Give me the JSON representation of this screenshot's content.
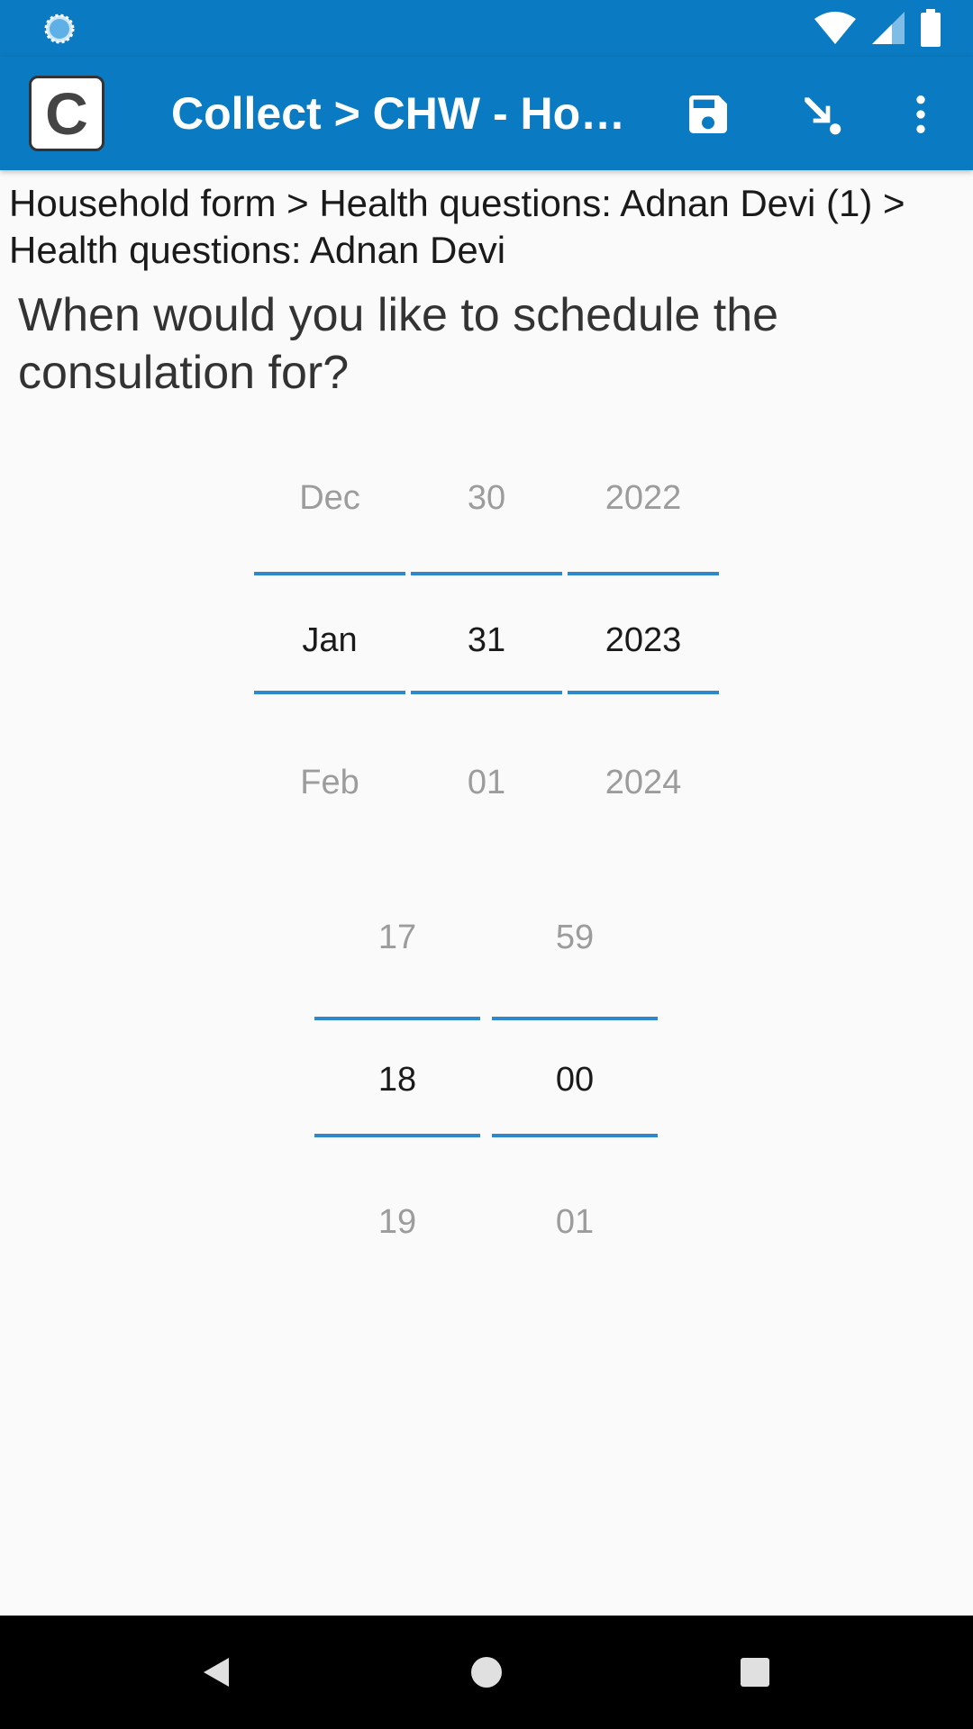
{
  "app_bar": {
    "logo_letter": "C",
    "title": "Collect > CHW - Ho…",
    "icons": [
      "save-icon",
      "jump-icon",
      "more-vert-icon"
    ]
  },
  "status_bar": {
    "icons": [
      "sync-icon",
      "wifi-icon",
      "cellular-signal-icon",
      "battery-icon"
    ]
  },
  "breadcrumb": "Household form > Health questions: Adnan Devi (1) > Health questions: Adnan Devi",
  "question": "When would you like to schedule the consulation for?",
  "date_picker": {
    "month": {
      "prev": "Dec",
      "current": "Jan",
      "next": "Feb"
    },
    "day": {
      "prev": "30",
      "current": "31",
      "next": "01"
    },
    "year": {
      "prev": "2022",
      "current": "2023",
      "next": "2024"
    }
  },
  "time_picker": {
    "hour": {
      "prev": "17",
      "current": "18",
      "next": "19"
    },
    "minute": {
      "prev": "59",
      "current": "00",
      "next": "01"
    }
  },
  "nav_bar": {
    "icons": [
      "back-icon",
      "home-icon",
      "recents-icon"
    ]
  },
  "colors": {
    "primary": "#0a7bc3",
    "picker_line": "#2f88c9",
    "background": "#fafafa"
  }
}
